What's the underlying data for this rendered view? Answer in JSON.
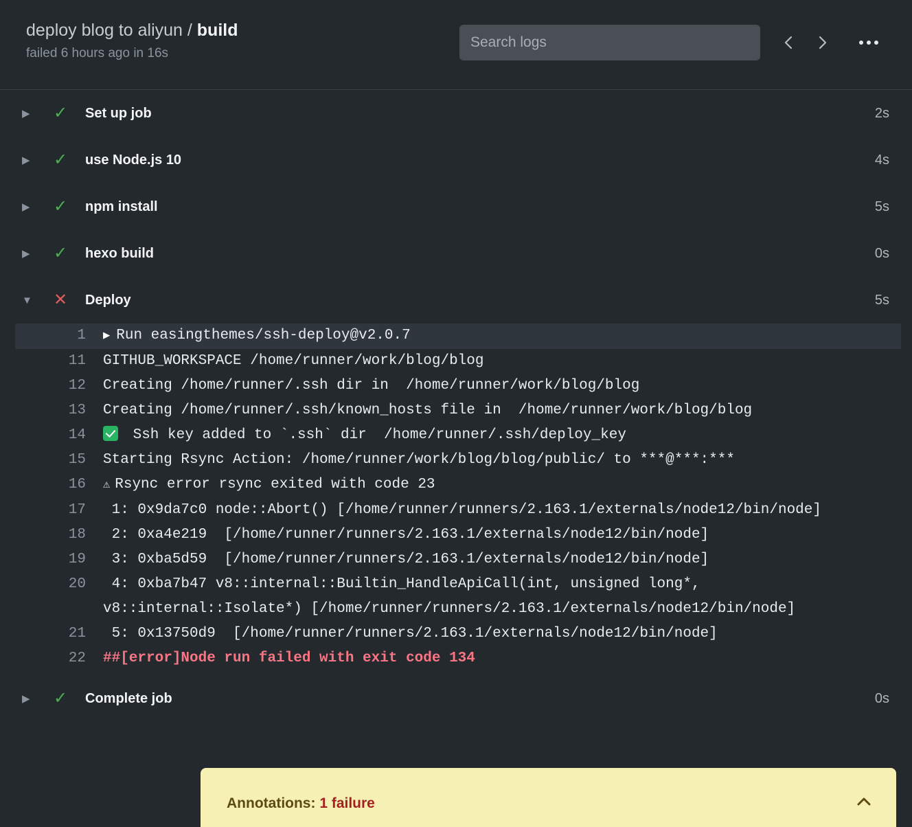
{
  "header": {
    "workflow_name": "deploy blog to aliyun / ",
    "job_name": "build",
    "subtitle": "failed 6 hours ago in 16s",
    "search_placeholder": "Search logs",
    "prev_icon": "chevron-left-icon",
    "next_icon": "chevron-right-icon",
    "kebab_icon": "kebab-horizontal-icon"
  },
  "steps": [
    {
      "caret": "▶",
      "status_icon": "✓",
      "status": "success",
      "label": "Set up job",
      "duration": "2s",
      "expanded": false
    },
    {
      "caret": "▶",
      "status_icon": "✓",
      "status": "success",
      "label": "use Node.js 10",
      "duration": "4s",
      "expanded": false
    },
    {
      "caret": "▶",
      "status_icon": "✓",
      "status": "success",
      "label": "npm install",
      "duration": "5s",
      "expanded": false
    },
    {
      "caret": "▶",
      "status_icon": "✓",
      "status": "success",
      "label": "hexo build",
      "duration": "0s",
      "expanded": false
    },
    {
      "caret": "▼",
      "status_icon": "✕",
      "status": "failure",
      "label": "Deploy",
      "duration": "5s",
      "expanded": true
    },
    {
      "caret": "▶",
      "status_icon": "✓",
      "status": "success",
      "label": "Complete job",
      "duration": "0s",
      "expanded": false
    }
  ],
  "log": [
    {
      "num": "1",
      "text": "Run easingthemes/ssh-deploy@v2.0.7",
      "highlight": true,
      "leading": "run-caret"
    },
    {
      "num": "11",
      "text": "GITHUB_WORKSPACE /home/runner/work/blog/blog"
    },
    {
      "num": "12",
      "text": "Creating /home/runner/.ssh dir in  /home/runner/work/blog/blog"
    },
    {
      "num": "13",
      "text": "Creating /home/runner/.ssh/known_hosts file in  /home/runner/work/blog/blog"
    },
    {
      "num": "14",
      "text": " Ssh key added to `.ssh` dir  /home/runner/.ssh/deploy_key",
      "leading": "emoji-check"
    },
    {
      "num": "15",
      "text": "Starting Rsync Action: /home/runner/work/blog/blog/public/ to ***@***:***"
    },
    {
      "num": "16",
      "text": "Rsync error rsync exited with code 23",
      "leading": "warning-triangle"
    },
    {
      "num": "17",
      "text": " 1: 0x9da7c0 node::Abort() [/home/runner/runners/2.163.1/externals/node12/bin/node]"
    },
    {
      "num": "18",
      "text": " 2: 0xa4e219  [/home/runner/runners/2.163.1/externals/node12/bin/node]"
    },
    {
      "num": "19",
      "text": " 3: 0xba5d59  [/home/runner/runners/2.163.1/externals/node12/bin/node]"
    },
    {
      "num": "20",
      "text": " 4: 0xba7b47 v8::internal::Builtin_HandleApiCall(int, unsigned long*, v8::internal::Isolate*) [/home/runner/runners/2.163.1/externals/node12/bin/node]"
    },
    {
      "num": "21",
      "text": " 5: 0x13750d9  [/home/runner/runners/2.163.1/externals/node12/bin/node]"
    },
    {
      "num": "22",
      "text": "##[error]Node run failed with exit code 134",
      "error": true
    }
  ],
  "annotations": {
    "label": "Annotations: ",
    "count": "1 failure",
    "chevron_icon": "chevron-up-icon",
    "chevron": "˄"
  },
  "colors": {
    "background": "#24292e",
    "success": "#4caf50",
    "failure": "#e05c5c",
    "error_text": "#f97583",
    "banner_bg": "#f7f0b5",
    "banner_text": "#5c4a12",
    "banner_count": "#a52121"
  }
}
